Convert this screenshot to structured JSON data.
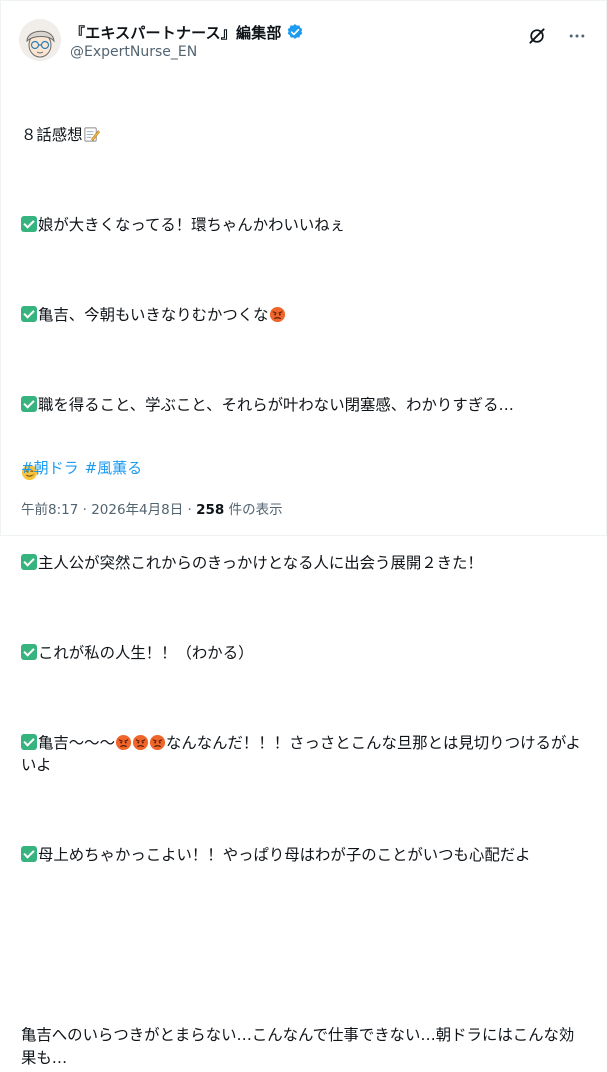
{
  "author": {
    "display_name": "『エキスパートナース』編集部",
    "handle": "@ExpertNurse_EN"
  },
  "post": {
    "line1_text": "８話感想",
    "checks": [
      "娘が大きくなってる！環ちゃんかわいいねぇ",
      "亀吉、今朝もいきなりむかつくな",
      "職を得ること、学ぶこと、それらが叶わない閉塞感、わかりすぎる…",
      "主人公が突然これからのきっかけとなる人に出会う展開２きた！",
      "これが私の人生！！（わかる）",
      "亀吉〜〜〜",
      "母上めちゃかっこよい！！やっぱり母はわが子のことがいつも心配だよ"
    ],
    "check6_suffix": "なんなんだ！！！さっさとこんな旦那とは見切りつけるがよいよ",
    "closing": "亀吉へのいらつきがとまらない…こんなんで仕事できない…朝ドラにはこんな効果も…",
    "hashtags": [
      "#朝ドラ",
      "#風薫る"
    ]
  },
  "meta": {
    "time": "午前8:17",
    "sep": " · ",
    "date": "2026年4月8日",
    "views_count": "258",
    "views_label": " 件の表示"
  },
  "icons": {
    "verified": "verified-badge-icon",
    "grok": "grok-icon",
    "more": "more-icon",
    "memo": "memo-icon",
    "angry": "angry-face-icon",
    "tear": "smiling-face-with-tear-icon",
    "check": "check-mark-icon"
  },
  "colors": {
    "accent": "#1d9bf0",
    "check_green": "#36b37e",
    "angry_face": "#f0662a",
    "secondary_text": "#536471"
  }
}
